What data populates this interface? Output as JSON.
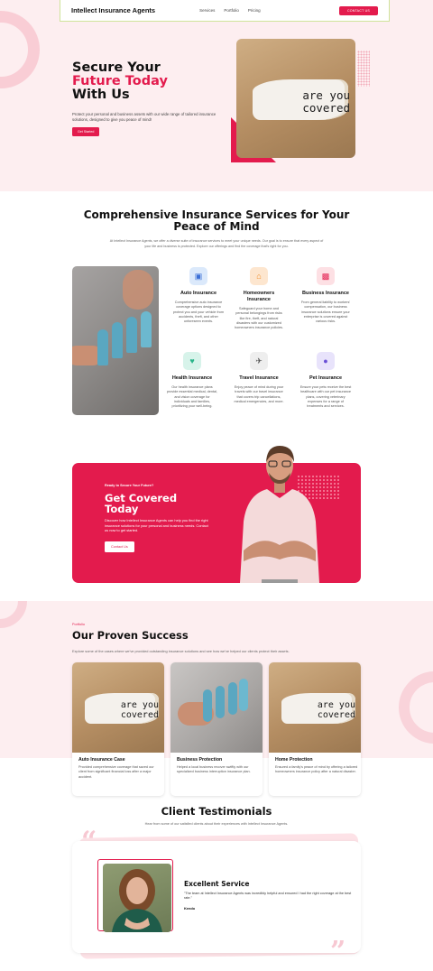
{
  "nav": {
    "brand": "Intellect Insurance Agents",
    "links": [
      "Services",
      "Portfolio",
      "Pricing"
    ],
    "cta": "CONTACT US"
  },
  "hero": {
    "title_line1": "Secure Your",
    "title_line2": "Future Today",
    "title_line3": "With Us",
    "text": "Protect your personal and business assets with our wide range of tailored insurance solutions, designed to give you peace of mind!",
    "button": "Get Started",
    "photo_text_line1": "are you",
    "photo_text_line2": "covered"
  },
  "services": {
    "title": "Comprehensive Insurance Services for Your Peace of Mind",
    "intro": "At Intellect Insurance Agents, we offer a diverse suite of insurance services to meet your unique needs. Our goal is to ensure that every aspect of your life and business is protected. Explore our offerings and find the coverage that's right for you.",
    "items": [
      {
        "icon": "car-icon",
        "color": "#dbe9fb",
        "glyph": "🚗",
        "title": "Auto Insurance",
        "desc": "Comprehensive auto insurance coverage options designed to protect you and your vehicle from accidents, theft, and other unforeseen events."
      },
      {
        "icon": "home-icon",
        "color": "#fde6cf",
        "glyph": "🏠",
        "title": "Homeowners Insurance",
        "desc": "Safeguard your home and personal belongings from risks like fire, theft, and natural disasters with our customized homeowners insurance policies."
      },
      {
        "icon": "briefcase-icon",
        "color": "#fde0e4",
        "glyph": "💼",
        "title": "Business Insurance",
        "desc": "From general liability to workers' compensation, our business insurance solutions ensure your enterprise is covered against various risks."
      },
      {
        "icon": "heart-icon",
        "color": "#d7f3ea",
        "glyph": "❤",
        "title": "Health Insurance",
        "desc": "Our health insurance plans provide essential medical, dental, and vision coverage for individuals and families, prioritizing your well-being."
      },
      {
        "icon": "plane-icon",
        "color": "#eeeeee",
        "glyph": "✈",
        "title": "Travel Insurance",
        "desc": "Enjoy peace of mind during your travels with our travel insurance that covers trip cancellations, medical emergencies, and more."
      },
      {
        "icon": "paw-icon",
        "color": "#e8e3fb",
        "glyph": "🐾",
        "title": "Pet Insurance",
        "desc": "Ensure your pets receive the best healthcare with our pet insurance plans, covering veterinary expenses for a range of treatments and services."
      }
    ]
  },
  "cta": {
    "kicker": "Ready to Secure Your Future?",
    "title_line1": "Get Covered",
    "title_line2": "Today",
    "text": "Discover how Intellect Insurance Agents can help you find the right insurance solutions for your personal and business needs. Contact us now to get started.",
    "button": "Contact Us"
  },
  "portfolio": {
    "kicker": "Portfolio",
    "title": "Our Proven Success",
    "intro": "Explore some of the cases where we've provided outstanding insurance solutions and see how we've helped our clients protect their assets.",
    "cards": [
      {
        "title": "Auto Insurance Case",
        "desc": "Provided comprehensive coverage that saved our client from significant financial loss after a major accident."
      },
      {
        "title": "Business Protection",
        "desc": "Helped a local business recover swiftly with our specialized business interruption insurance plan."
      },
      {
        "title": "Home Protection",
        "desc": "Ensured a family's peace of mind by offering a tailored homeowners insurance policy after a natural disaster."
      }
    ]
  },
  "testimonials": {
    "title": "Client Testimonials",
    "intro": "Hear from some of our satisfied clients about their experiences with Intellect Insurance Agents.",
    "heading": "Excellent Service",
    "quote": "\"The team at Intellect Insurance Agents was incredibly helpful and ensured I had the right coverage at the best rate.\"",
    "name": "Kendo"
  },
  "colors": {
    "accent": "#e31b4d",
    "hero_bg": "#fdeef0"
  }
}
